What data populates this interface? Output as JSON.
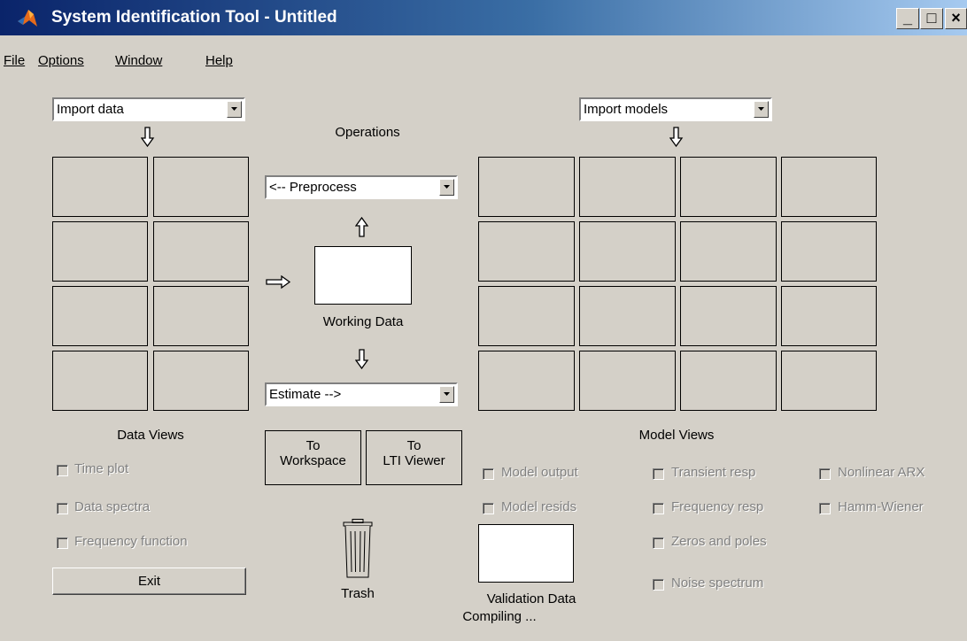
{
  "window": {
    "title": "System Identification Tool - Untitled",
    "minimize_glyph": "_",
    "maximize_glyph": "□",
    "close_glyph": "×"
  },
  "menu": [
    "File",
    "Options",
    "Window",
    "Help"
  ],
  "data_panel": {
    "import_combo": "Import data",
    "views_label": "Data Views",
    "checkboxes": [
      "Time plot",
      "Data spectra",
      "Frequency function"
    ],
    "exit_button": "Exit"
  },
  "operations": {
    "label": "Operations",
    "preprocess_combo": "<-- Preprocess",
    "working_data_label": "Working Data",
    "estimate_combo": "Estimate -->",
    "to_workspace": [
      "To",
      "Workspace"
    ],
    "to_lti_viewer": [
      "To",
      "LTI Viewer"
    ],
    "trash_label": "Trash"
  },
  "model_panel": {
    "import_combo": "Import models",
    "views_label": "Model Views",
    "checkboxes_col1": [
      "Model output",
      "Model resids"
    ],
    "checkboxes_col2": [
      "Transient resp",
      "Frequency resp",
      "Zeros and poles",
      "Noise spectrum"
    ],
    "checkboxes_col3": [
      "Nonlinear ARX",
      "Hamm-Wiener"
    ],
    "validation_label": "Validation Data",
    "status": "Compiling ..."
  },
  "icons": {
    "app": "matlab-logo-icon",
    "arrow": "arrow-icon",
    "trash": "trash-can-icon"
  }
}
